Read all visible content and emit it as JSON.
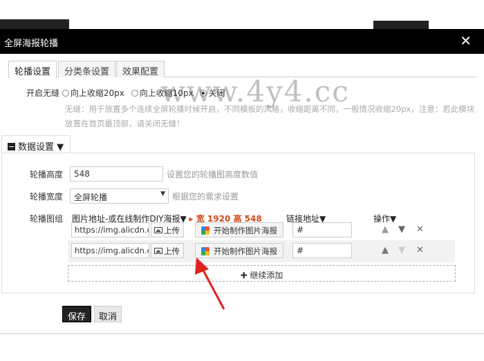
{
  "dialog": {
    "title": "全屏海报轮播",
    "close_glyph": "✕"
  },
  "tabs": [
    {
      "label": "轮播设置",
      "active": true
    },
    {
      "label": "分类条设置",
      "active": false
    },
    {
      "label": "效果配置",
      "active": false
    }
  ],
  "seam": {
    "label": "开启无缝",
    "options": [
      {
        "label": "向上收缩20px",
        "selected": false
      },
      {
        "label": "向上收缩10px",
        "selected": false
      },
      {
        "label": "关闭",
        "selected": true
      }
    ],
    "hint": "无缝：用于放置多个连续全屏轮播时候开启，不同模板的风格，收缩距离不同，一般情况收缩20px，注意：若此模块放置在首页最顶部，请关闭无缝！"
  },
  "section": {
    "title": "数据设置 ▼"
  },
  "height_field": {
    "label": "轮播高度",
    "value": "548",
    "desc": "设置您的轮播图高度数值"
  },
  "width_field": {
    "label": "轮播宽度",
    "value": "全屏轮播",
    "desc": "根据您的需求设置"
  },
  "images": {
    "label": "轮播图组",
    "col_image": "图片地址-或在线制作DIY海报▼",
    "size_note": "▸ 宽 1920 高 548",
    "col_link": "链接地址▼",
    "col_ops": "操作▼",
    "rows": [
      {
        "url": "https://img.alicdn.com",
        "upload": "上传",
        "make": "开始制作图片海报",
        "link": "#"
      },
      {
        "url": "https://img.alicdn.com",
        "upload": "上传",
        "make": "开始制作图片海报",
        "link": "#"
      }
    ],
    "add_label": "✚ 继续添加"
  },
  "footer": {
    "save": "保存",
    "cancel": "取消"
  },
  "watermark": "www.4y4.cc",
  "colors": {
    "titlebar": "#000000",
    "accent_note": "#d04a1a",
    "arrow": "#e02020"
  }
}
